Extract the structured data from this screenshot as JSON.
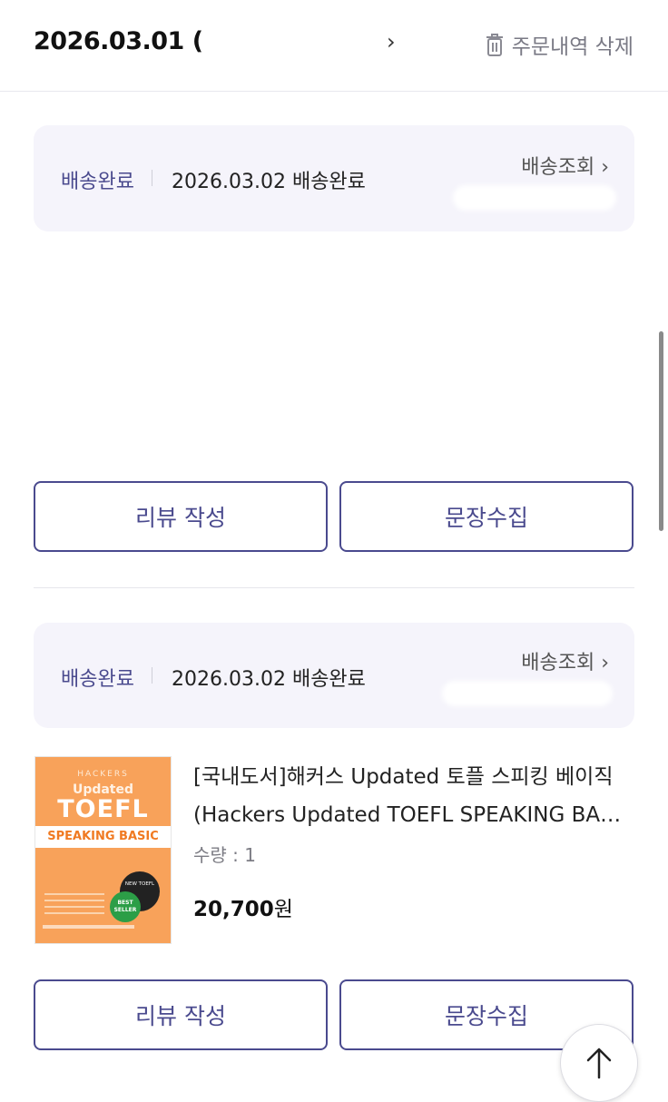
{
  "header": {
    "order_date": "2026.03.01 (",
    "arrow": "›",
    "delete_label": "주문내역 삭제"
  },
  "shipments": [
    {
      "status": "배송완료",
      "date_text": "2026.03.02 배송완료",
      "track_label": "배송조회 ›"
    },
    {
      "status": "배송완료",
      "date_text": "2026.03.02 배송완료",
      "track_label": "배송조회 ›"
    }
  ],
  "actions": {
    "review_label": "리뷰 작성",
    "collect_label": "문장수집"
  },
  "product": {
    "title_line1": "[국내도서]해커스 Updated 토플 스피킹 베이직",
    "title_line2": "(Hackers Updated TOEFL SPEAKING BASIC",
    "quantity": "수량 : 1",
    "price_value": "20,700",
    "price_unit": "원",
    "cover": {
      "brand": "HACKERS",
      "updated": "Updated",
      "toefl": "TOEFL",
      "band": "SPEAKING BASIC",
      "new_badge": "NEW TOEFL",
      "best_badge": "BEST SELLER"
    }
  },
  "colors": {
    "accent": "#4a4a8e",
    "ship_bg": "#f5f4fb",
    "cover_orange": "#f8a25a"
  },
  "icons": {
    "delete": "trash-icon",
    "track": "chevron-right-icon",
    "scroll_top": "arrow-up-icon"
  }
}
